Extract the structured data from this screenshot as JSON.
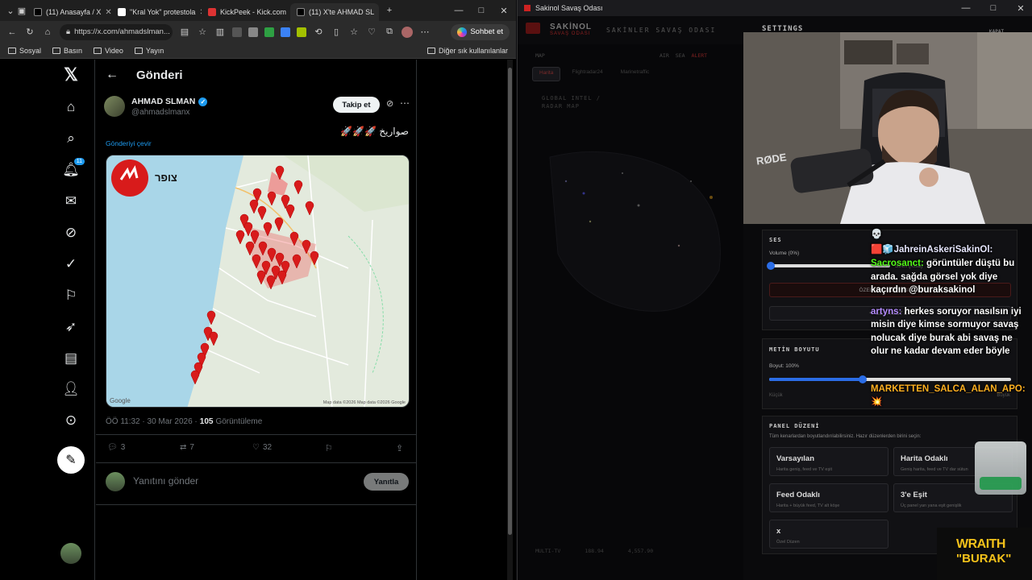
{
  "browser": {
    "tabs": [
      {
        "label": "(11) Anasayfa / X",
        "color": "#000"
      },
      {
        "label": "\"Kral Yok\" protestola",
        "color": "#fff"
      },
      {
        "label": "KickPeek - Kick.com",
        "color": "#d33"
      },
      {
        "label": "(11) X'te AHMAD SL",
        "color": "#000"
      }
    ],
    "url": "https://x.com/ahmadslman...",
    "copilot_label": "Sohbet et",
    "bookmarks": [
      "Sosyal",
      "Basın",
      "Video",
      "Yayın"
    ],
    "bookmarks_right": "Diğer sık kullanılanlar"
  },
  "x": {
    "nav_badge": "11",
    "header_title": "Gönderi",
    "author_name": "AHMAD SLMAN",
    "author_handle": "@ahmadslmanx",
    "follow_label": "Takip et",
    "post_text": "🚀🚀🚀 صواريخ",
    "translate_label": "Gönderiyi çevir",
    "map": {
      "badge_text": "צופר",
      "google": "Google",
      "copyright": "Map data ©2026 Map data ©2026 Google"
    },
    "time": "ÖÖ 11:32 · 30 Mar 2026 ·",
    "views_count": "105",
    "views_label": "Görüntüleme",
    "stats": {
      "replies": "3",
      "reposts": "7",
      "likes": "32"
    },
    "reply_placeholder": "Yanıtını gönder",
    "reply_button": "Yanıtla"
  },
  "app": {
    "window_title": "Sakinol Savaş Odası",
    "logo_main": "SAKİNOL",
    "logo_sub": "SAVAŞ ODASI",
    "room_title": "SAKİNLER SAVAŞ ODASI",
    "settings_title": "SETTINGS",
    "close_label": "KAPAT",
    "map_label": "MAP",
    "filters": [
      "AIR",
      "SEA",
      "ALERT"
    ],
    "tabs": [
      "Harita",
      "Flightradar24",
      "Marinetraffic"
    ],
    "radar_title": "GLOBAL INTEL / RADAR MAP",
    "ses": {
      "title": "SES",
      "volume_label": "Volume (0%)",
      "siren_label": "Siren (Kısa)",
      "file_button": "ÖZEL SES DOSYASI SEÇ",
      "test_button": "SESİ TEST ET"
    },
    "metin": {
      "title": "METİN BOYUTU",
      "size_label": "Boyut: 100%",
      "min_label": "Küçük",
      "max_label": "Büyük"
    },
    "panel": {
      "title": "PANEL DÜZENİ",
      "desc": "Tüm kenarlardan boyutlandırılabilirsiniz. Hazır düzenlerden birini seçin:",
      "presets": [
        {
          "title": "Varsayılan",
          "desc": "Harita geniş, feed ve TV eşit"
        },
        {
          "title": "Harita Odaklı",
          "desc": "Geniş harita, feed ve TV dar sütun"
        },
        {
          "title": "Feed Odaklı",
          "desc": "Harita + büyük feed, TV alt köşe"
        },
        {
          "title": "3'e Eşit",
          "desc": "Üç panel yan yana eşit genişlik"
        },
        {
          "title": "x",
          "desc": "Özel Düzen"
        }
      ]
    },
    "footer": {
      "tv": "MULTI-TV",
      "a": "188.94",
      "b": "4,557.90"
    }
  },
  "chat": [
    {
      "user": "",
      "text": "💀",
      "color": "#fff"
    },
    {
      "user": "🟥🧊JahreinAskeriSakinOl:",
      "text": "",
      "color": "#e7e7ff"
    },
    {
      "user": "Sacrosanct:",
      "text": "görüntüler düştü bu arada. sağda görsel yok diye kaçırdın @buraksakinol",
      "color": "#53fc18"
    },
    {
      "user": "artyns:",
      "text": "herkes soruyor nasılsın iyi misin diye kimse sormuyor savaş nolucak diye burak abi savaş ne olur ne kadar devam eder böyle",
      "color": "#b58cff"
    },
    {
      "user": "MARKETTEN_SALCA_ALAN_APO:",
      "text": "💥",
      "color": "#ffb020"
    }
  ],
  "overlay": {
    "logo_line1": "WRAITH",
    "logo_line2": "\"BURAK\"",
    "mic_brand": "RØDE"
  },
  "colors": {
    "accent": "#d81b1b",
    "x_blue": "#1d9bf0",
    "kick_green": "#53fc18"
  }
}
